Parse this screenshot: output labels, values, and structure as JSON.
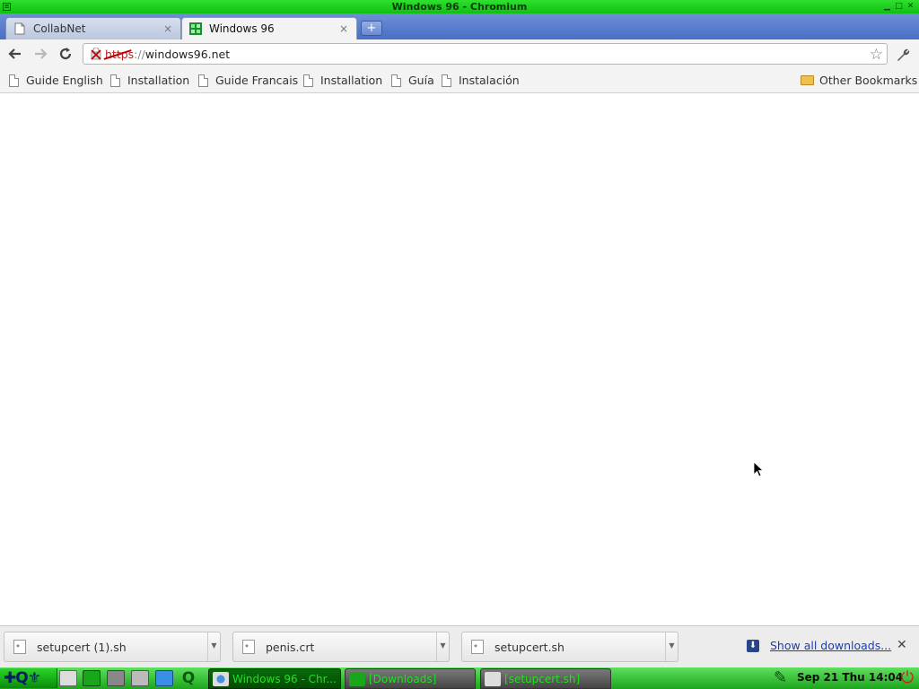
{
  "window": {
    "title": "Windows 96 - Chromium",
    "menu_icon": "window-menu-icon",
    "controls": {
      "minimize": "minimize-icon",
      "maximize": "maximize-icon",
      "close": "close-icon"
    }
  },
  "tabs": [
    {
      "label": "CollabNet",
      "active": false,
      "icon": "page-icon",
      "close": "×"
    },
    {
      "label": "Windows 96",
      "active": true,
      "icon": "windows96-favicon",
      "close": "×"
    }
  ],
  "new_tab": "+",
  "toolbar": {
    "back": "back-arrow-icon",
    "forward": "forward-arrow-icon",
    "reload": "reload-icon",
    "url_scheme": "https",
    "url_sep": "://",
    "url_rest": "windows96.net",
    "security_icon": "insecure-https-icon",
    "bookmark_star": "star-icon",
    "menu": "wrench-icon"
  },
  "bookmarks": [
    {
      "label": "Guide English"
    },
    {
      "label": "Installation"
    },
    {
      "label": "Guide Francais"
    },
    {
      "label": "Installation"
    },
    {
      "label": "Guía"
    },
    {
      "label": "Instalación"
    }
  ],
  "other_bookmarks": "Other Bookmarks",
  "downloads": [
    {
      "name": "setupcert (1).sh"
    },
    {
      "name": "penis.crt"
    },
    {
      "name": "setupcert.sh"
    }
  ],
  "show_all_downloads": "Show all downloads...",
  "shelf_close": "✕",
  "taskbar": {
    "start_label": "✚Q⚜",
    "tasks": [
      {
        "label": "Windows 96 - Chr...",
        "active": true
      },
      {
        "label": "[Downloads]",
        "active": false
      },
      {
        "label": "[setupcert.sh]",
        "active": false
      }
    ],
    "clock": "Sep 21 Thu 14:04"
  },
  "colors": {
    "titlebar": "#1fd01f",
    "tabstrip": "#5a7ecc",
    "taskbar": "#2bbf2b",
    "insecure": "#c00000",
    "link": "#1b3eb5"
  }
}
